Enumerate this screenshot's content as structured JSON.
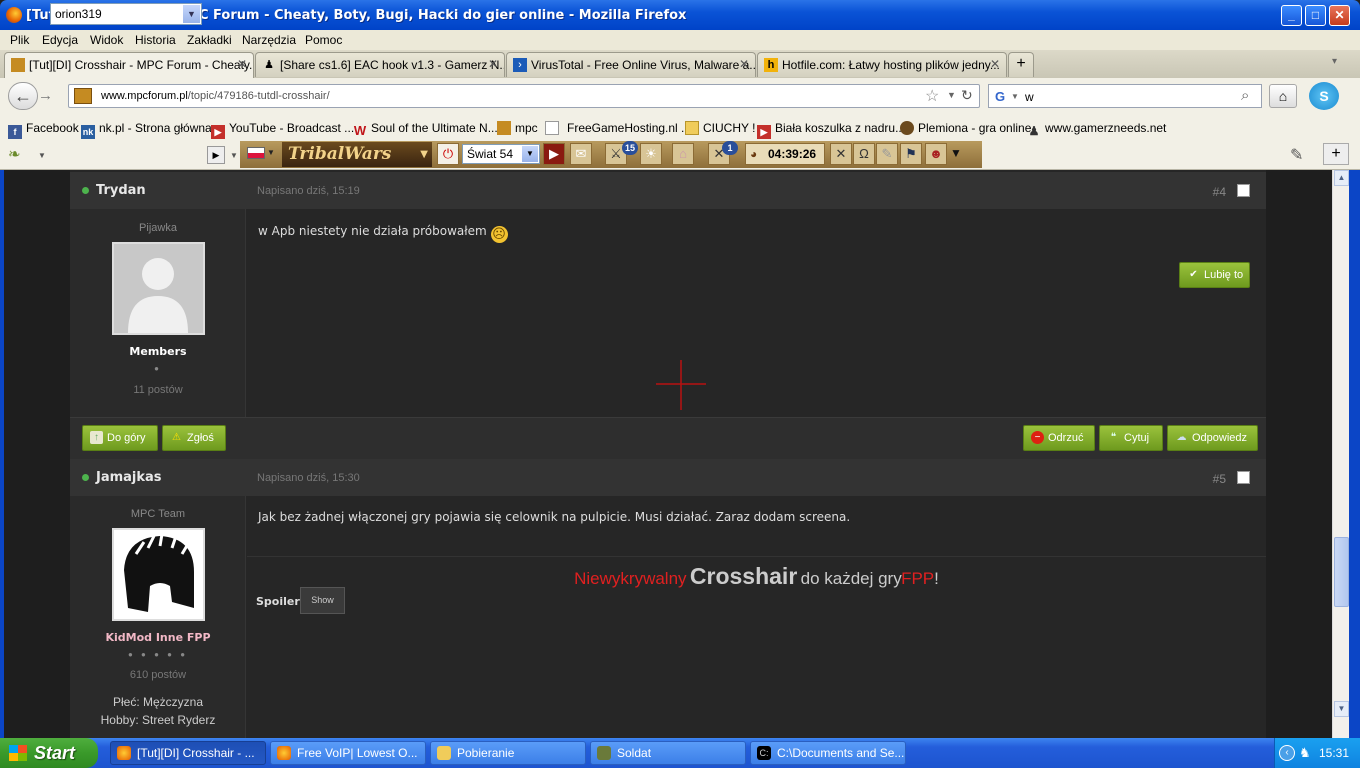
{
  "window": {
    "title": "[Tut][DI] Crosshair - MPC Forum - Cheaty, Boty, Bugi, Hacki do gier online - Mozilla Firefox",
    "controls": [
      "_",
      "□",
      "✕"
    ]
  },
  "menu": [
    "Plik",
    "Edycja",
    "Widok",
    "Historia",
    "Zakładki",
    "Narzędzia",
    "Pomoc"
  ],
  "tabs": [
    {
      "label": "[Tut][DI] Crosshair - MPC Forum - Cheaty...",
      "icon": "mpc-icon",
      "active": true
    },
    {
      "label": "[Share cs1.6] EAC hook v1.3 - Gamerz N...",
      "icon": "gamer-icon",
      "active": false
    },
    {
      "label": "VirusTotal - Free Online Virus, Malware a...",
      "icon": "virustotal-icon",
      "active": false
    },
    {
      "label": "Hotfile.com: Łatwy hosting plików jedny...",
      "icon": "hotfile-icon",
      "active": false
    }
  ],
  "newtab": "+",
  "tab_list": "▾",
  "nav": {
    "url_host": "www.mpcforum.pl",
    "url_path": "/topic/479186-tutdl-crosshair/",
    "search": "w",
    "back": "←",
    "forward": "→",
    "star": "☆",
    "reload": "↻",
    "home": "⌂",
    "search_go": "⌕"
  },
  "bookmarks": [
    "Facebook",
    "nk.pl - Strona główna",
    "YouTube - Broadcast ...",
    "Soul of the Ultimate N...",
    "mpc",
    "FreeGameHosting.nl ...",
    "CIUCHY !",
    "Biała koszulka z nadru...",
    "Plemiona - gra online",
    "www.gamerzneeds.net"
  ],
  "tribal": {
    "user": "orion319",
    "logo": "TribalWars",
    "world": "Świat 54",
    "badge_reports": "15",
    "badge_attacks": "1",
    "time": "04:39:26"
  },
  "posts": [
    {
      "author": "Trydan",
      "date": "Napisano dziś, 15:19",
      "num": "#4",
      "rank": "Pijawka",
      "group": "Members",
      "pips": "●",
      "count": "11 postów",
      "text": "w Apb niestety nie działa próbowałem",
      "emoji": "☹",
      "like": "Lubię to"
    },
    {
      "author": "Jamajkas",
      "date": "Napisano dziś, 15:30",
      "num": "#5",
      "rank": "MPC Team",
      "group": "KidMod Inne FPP",
      "pips": "● ● ● ● ●",
      "count": "610 postów",
      "gender": "Płeć: Mężczyzna",
      "hobby": "Hobby: Street Ryderz",
      "text": "Jak bez żadnej włączonej gry pojawia się celownik na pulpicie. Musi działać. Zaraz dodam screena."
    }
  ],
  "actions": {
    "top": "Do góry",
    "report": "Zgłoś",
    "reject": "Odrzuć",
    "quote": "Cytuj",
    "reply": "Odpowiedz"
  },
  "banner": {
    "w1": "Niewykrywalny",
    "w2": "Crosshair",
    "w3": "do każdej gry",
    "w4": "FPP",
    "w5": "!"
  },
  "spoiler": {
    "label": "Spoiler",
    "button": "Show"
  },
  "taskbar": {
    "start": "Start",
    "tasks": [
      "[Tut][DI] Crosshair - ...",
      "Free VoIP| Lowest O...",
      "Pobieranie",
      "Soldat",
      "C:\\Documents and Se..."
    ],
    "clock": "15:31"
  },
  "colors": {
    "accent_green": "#7fad28",
    "banner_red": "#e02020",
    "xp_blue": "#245edb"
  }
}
